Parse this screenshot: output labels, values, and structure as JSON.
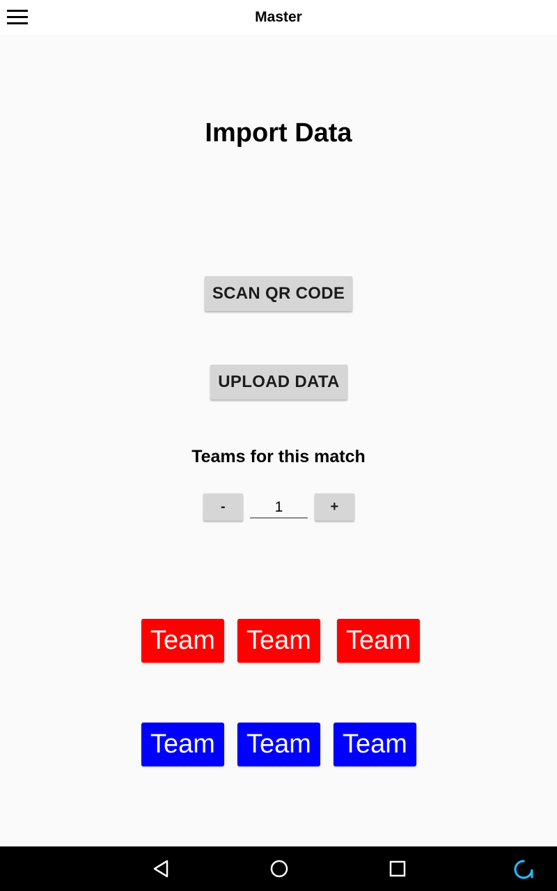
{
  "app_bar": {
    "title": "Master",
    "menu_icon": "hamburger-menu-icon"
  },
  "main": {
    "title": "Import Data",
    "scan_button": "SCAN QR CODE",
    "upload_button": "UPLOAD DATA",
    "teams_label": "Teams for this match",
    "stepper": {
      "minus_label": "-",
      "value": "1",
      "plus_label": "+"
    }
  },
  "teams": {
    "red_color": "#ff0000",
    "blue_color": "#0000ff",
    "red": [
      {
        "label": "Team"
      },
      {
        "label": "Team"
      },
      {
        "label": "Team"
      }
    ],
    "blue": [
      {
        "label": "Team"
      },
      {
        "label": "Team"
      },
      {
        "label": "Team"
      }
    ]
  },
  "nav_bar": {
    "back_icon": "back-triangle-icon",
    "home_icon": "home-circle-icon",
    "recents_icon": "recents-square-icon",
    "assistant_icon": "assistant-ring-icon",
    "assistant_color": "#29b6f6"
  }
}
